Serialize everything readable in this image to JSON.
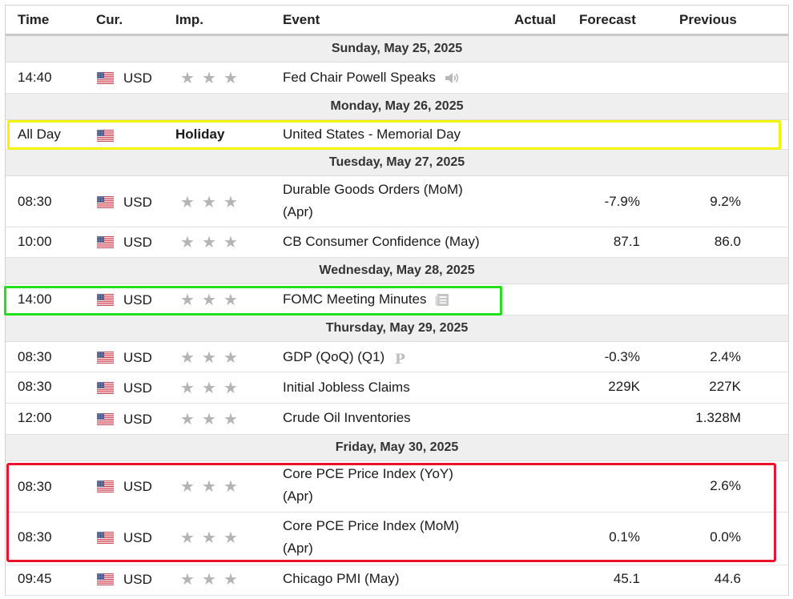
{
  "headers": {
    "time": "Time",
    "currency": "Cur.",
    "importance": "Imp.",
    "event": "Event",
    "actual": "Actual",
    "forecast": "Forecast",
    "previous": "Previous"
  },
  "days": [
    {
      "date": "Sunday, May 25, 2025",
      "events": [
        {
          "time": "14:40",
          "currency": "USD",
          "importance": 3,
          "event": "Fed Chair Powell Speaks",
          "event_suffix_icon": "speaker-icon",
          "actual": "",
          "forecast": "",
          "previous": ""
        }
      ]
    },
    {
      "date": "Monday, May 26, 2025",
      "events": [
        {
          "time": "All Day",
          "currency": "",
          "importance_label": "Holiday",
          "event": "United States - Memorial Day",
          "actual": "",
          "forecast": "",
          "previous": ""
        }
      ]
    },
    {
      "date": "Tuesday, May 27, 2025",
      "events": [
        {
          "time": "08:30",
          "currency": "USD",
          "importance": 3,
          "event_line1": "Durable Goods Orders (MoM)",
          "event_line2": "(Apr)",
          "actual": "",
          "forecast": "-7.9%",
          "previous": "9.2%"
        },
        {
          "time": "10:00",
          "currency": "USD",
          "importance": 3,
          "event": "CB Consumer Confidence (May)",
          "actual": "",
          "forecast": "87.1",
          "previous": "86.0"
        }
      ]
    },
    {
      "date": "Wednesday, May 28, 2025",
      "events": [
        {
          "time": "14:00",
          "currency": "USD",
          "importance": 3,
          "event": "FOMC Meeting Minutes",
          "event_suffix_icon": "document-icon",
          "actual": "",
          "forecast": "",
          "previous": ""
        }
      ]
    },
    {
      "date": "Thursday, May 29, 2025",
      "events": [
        {
          "time": "08:30",
          "currency": "USD",
          "importance": 3,
          "event": "GDP (QoQ) (Q1)",
          "event_suffix": "P",
          "actual": "",
          "forecast": "-0.3%",
          "previous": "2.4%"
        },
        {
          "time": "08:30",
          "currency": "USD",
          "importance": 3,
          "event": "Initial Jobless Claims",
          "actual": "",
          "forecast": "229K",
          "previous": "227K"
        },
        {
          "time": "12:00",
          "currency": "USD",
          "importance": 3,
          "event": "Crude Oil Inventories",
          "actual": "",
          "forecast": "",
          "previous": "1.328M"
        }
      ]
    },
    {
      "date": "Friday, May 30, 2025",
      "events": [
        {
          "time": "08:30",
          "currency": "USD",
          "importance": 3,
          "event_line1": "Core PCE Price Index (YoY)",
          "event_line2": "(Apr)",
          "actual": "",
          "forecast": "",
          "previous": "2.6%"
        },
        {
          "time": "08:30",
          "currency": "USD",
          "importance": 3,
          "event_line1": "Core PCE Price Index (MoM)",
          "event_line2": "(Apr)",
          "actual": "",
          "forecast": "0.1%",
          "previous": "0.0%"
        },
        {
          "time": "09:45",
          "currency": "USD",
          "importance": 3,
          "event": "Chicago PMI (May)",
          "actual": "",
          "forecast": "45.1",
          "previous": "44.6"
        }
      ]
    }
  ],
  "highlight_colors": {
    "memorial_day": "#f4f400",
    "fomc_minutes": "#22e01a",
    "core_pce": "#e8142c"
  },
  "colors": {
    "star": "#b4b4b4",
    "day_header_bg": "#efeff0"
  }
}
